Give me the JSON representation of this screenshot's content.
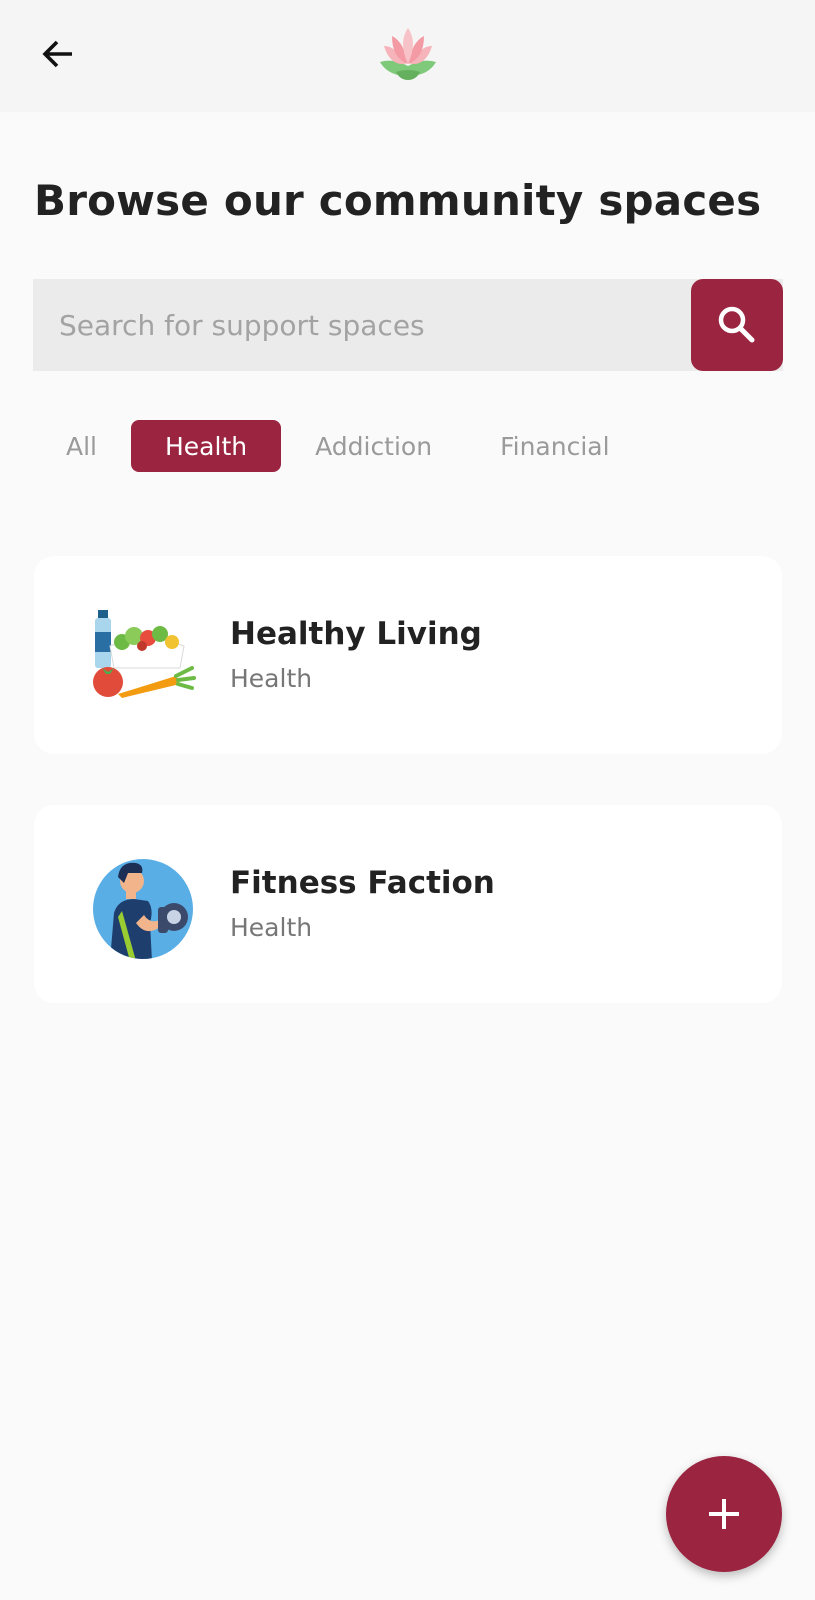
{
  "header": {
    "back_icon": "arrow-left-icon",
    "logo_icon": "lotus-icon"
  },
  "page": {
    "title": "Browse our community spaces"
  },
  "search": {
    "placeholder": "Search for support spaces",
    "value": "",
    "button_icon": "search-icon"
  },
  "filters": {
    "selected": "Health",
    "items": [
      {
        "label": "All"
      },
      {
        "label": "Health"
      },
      {
        "label": "Addiction"
      },
      {
        "label": "Financial"
      }
    ]
  },
  "spaces": [
    {
      "title": "Healthy Living",
      "category": "Health",
      "icon": "healthy-food-icon"
    },
    {
      "title": "Fitness Faction",
      "category": "Health",
      "icon": "fitness-dumbbell-icon"
    }
  ],
  "fab": {
    "icon": "plus-icon"
  },
  "colors": {
    "accent": "#9b2540",
    "background": "#fafafa",
    "app_bar": "#f5f5f5",
    "search_bg": "#ebebeb",
    "card_bg": "#ffffff"
  }
}
